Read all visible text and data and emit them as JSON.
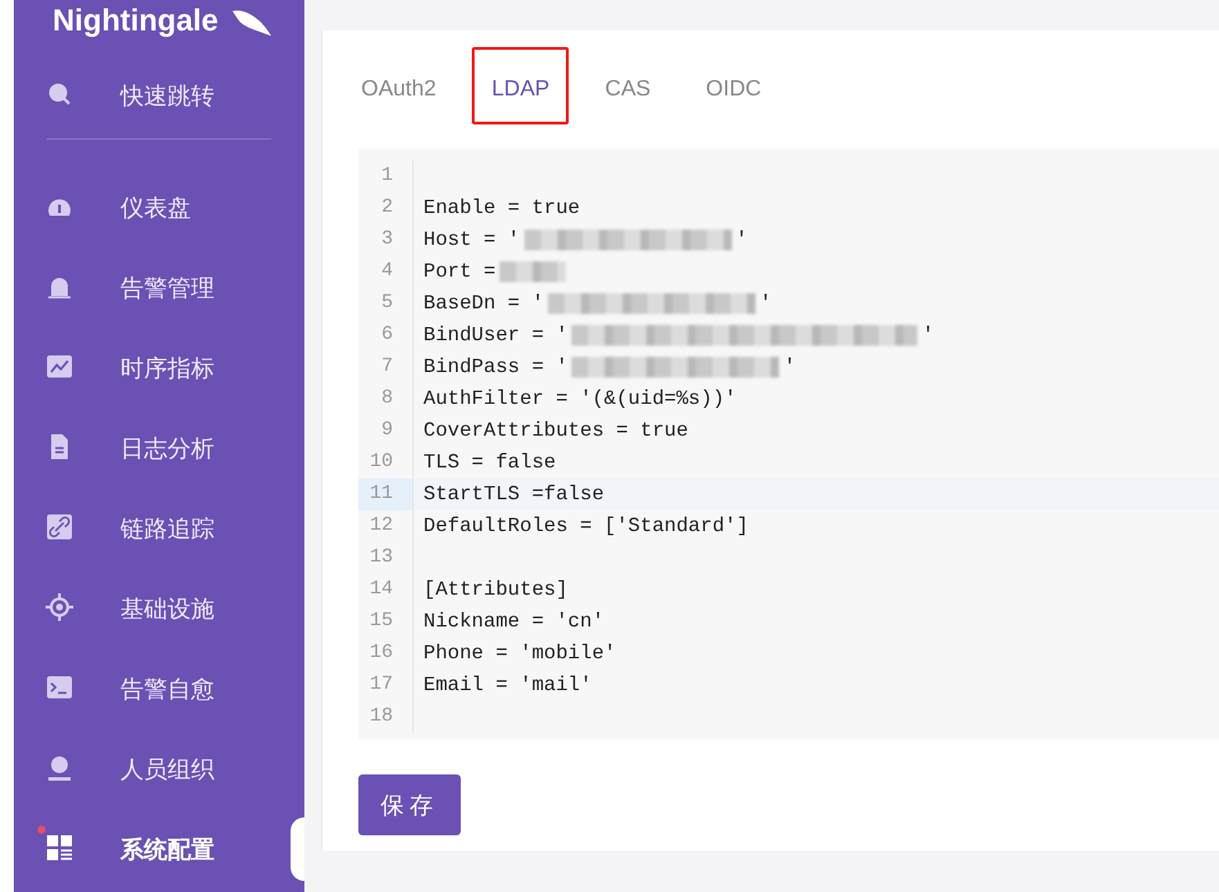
{
  "logo": {
    "text": "Nightingale"
  },
  "sidebar": {
    "items": [
      {
        "label": "快速跳转",
        "selected": false,
        "dot": false
      },
      {
        "label": "仪表盘",
        "selected": false,
        "dot": false
      },
      {
        "label": "告警管理",
        "selected": false,
        "dot": false
      },
      {
        "label": "时序指标",
        "selected": false,
        "dot": false
      },
      {
        "label": "日志分析",
        "selected": false,
        "dot": false
      },
      {
        "label": "链路追踪",
        "selected": false,
        "dot": false
      },
      {
        "label": "基础设施",
        "selected": false,
        "dot": false
      },
      {
        "label": "告警自愈",
        "selected": false,
        "dot": false
      },
      {
        "label": "人员组织",
        "selected": false,
        "dot": false
      },
      {
        "label": "系统配置",
        "selected": true,
        "dot": true
      }
    ]
  },
  "tabs": [
    {
      "label": "OAuth2",
      "selected": false,
      "annotated": false
    },
    {
      "label": "LDAP",
      "selected": true,
      "annotated": true
    },
    {
      "label": "CAS",
      "selected": false,
      "annotated": false
    },
    {
      "label": "OIDC",
      "selected": false,
      "annotated": false
    }
  ],
  "editor": {
    "lines": [
      {
        "number": "1",
        "active": false
      },
      {
        "number": "2",
        "text": "Enable = true",
        "active": false
      },
      {
        "number": "3",
        "text": "Host = '",
        "redacted": true,
        "after": "'",
        "active": false
      },
      {
        "number": "4",
        "text": "Port =",
        "redacted": true,
        "active": false
      },
      {
        "number": "5",
        "text": "BaseDn = '",
        "redacted": true,
        "after": "'",
        "active": false
      },
      {
        "number": "6",
        "text": "BindUser = '",
        "redacted": true,
        "after": "'",
        "active": false
      },
      {
        "number": "7",
        "text": "BindPass = '",
        "redacted": true,
        "after": "'",
        "active": false
      },
      {
        "number": "8",
        "text": "AuthFilter = '(&(uid=%s))'",
        "active": false
      },
      {
        "number": "9",
        "text": "CoverAttributes = true",
        "active": false
      },
      {
        "number": "10",
        "text": "TLS = false",
        "active": false
      },
      {
        "number": "11",
        "text": "StartTLS =false",
        "active": true
      },
      {
        "number": "12",
        "text": "DefaultRoles = ['Standard']",
        "active": false
      },
      {
        "number": "13",
        "active": false
      },
      {
        "number": "14",
        "text": "[Attributes]",
        "active": false
      },
      {
        "number": "15",
        "text": "Nickname = 'cn'",
        "active": false
      },
      {
        "number": "16",
        "text": "Phone = 'mobile'",
        "active": false
      },
      {
        "number": "17",
        "text": "Email = 'mail'",
        "active": false
      },
      {
        "number": "18",
        "active": false
      }
    ]
  },
  "save_button": {
    "label": "保存"
  }
}
